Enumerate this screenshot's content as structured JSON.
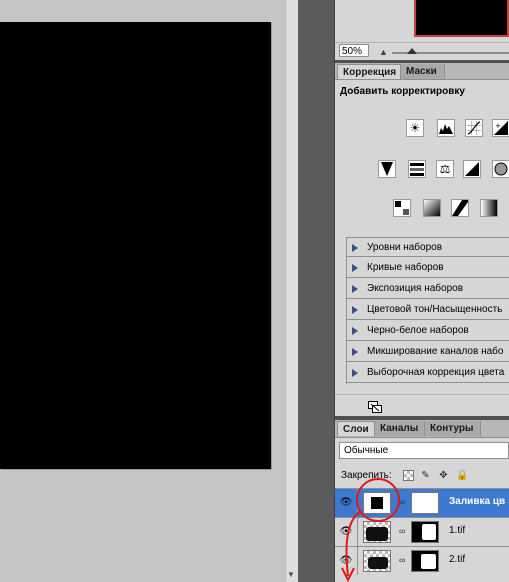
{
  "navigator": {
    "zoom": "50%"
  },
  "adjustments": {
    "tabs": [
      {
        "label": "Коррекция"
      },
      {
        "label": "Маски"
      }
    ],
    "title": "Добавить корректировку",
    "icon_rows": [
      [
        "brightness-contrast-icon",
        "levels-icon",
        "curves-icon",
        "exposure-icon"
      ],
      [
        "vibrance-icon",
        "hue-saturation-icon",
        "color-balance-icon",
        "black-white-icon",
        "photo-filter-icon"
      ],
      [
        "invert-icon",
        "posterize-icon",
        "threshold-icon",
        "gradient-map-icon"
      ]
    ],
    "presets": [
      {
        "label": "Уровни наборов"
      },
      {
        "label": "Кривые наборов"
      },
      {
        "label": "Экспозиция наборов"
      },
      {
        "label": "Цветовой тон/Насыщенность"
      },
      {
        "label": "Черно-белое наборов"
      },
      {
        "label": "Микширование каналов набо"
      },
      {
        "label": "Выборочная коррекция цвета"
      }
    ]
  },
  "layers": {
    "tabs": [
      {
        "label": "Слои"
      },
      {
        "label": "Каналы"
      },
      {
        "label": "Контуры"
      }
    ],
    "blend_mode": "Обычные",
    "lock_label": "Закрепить:",
    "items": [
      {
        "name": "Заливка цв",
        "selected": true
      },
      {
        "name": "1.tif",
        "selected": false
      },
      {
        "name": "2.tif",
        "selected": false
      }
    ]
  },
  "colors": {
    "selection": "#3d79d1",
    "annotation": "#e01818"
  }
}
